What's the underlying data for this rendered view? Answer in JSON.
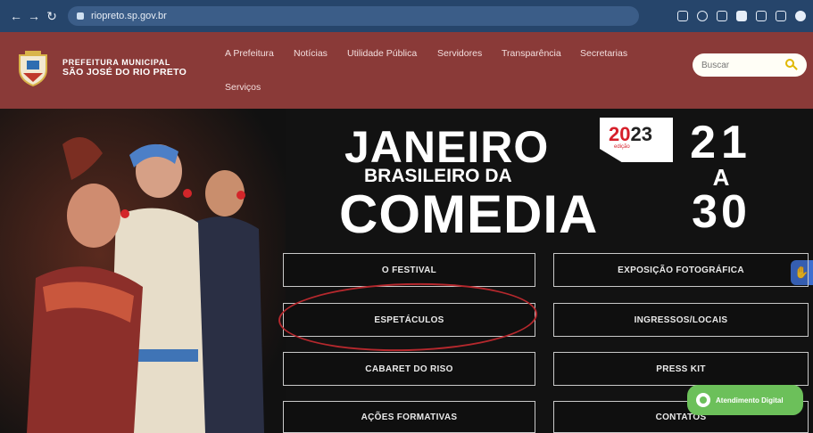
{
  "browser": {
    "url": "riopreto.sp.gov.br",
    "icons": [
      "back-icon",
      "forward-icon",
      "reload-icon",
      "translate-icon",
      "share-icon",
      "star-icon",
      "extension-icon",
      "media-icon",
      "sidebar-icon",
      "profile-icon"
    ]
  },
  "header": {
    "logo_top": "PREFEITURA MUNICIPAL",
    "logo_bottom": "SÃO JOSÉ DO RIO PRETO",
    "nav": [
      {
        "label": "A Prefeitura"
      },
      {
        "label": "Notícias"
      },
      {
        "label": "Utilidade Pública"
      },
      {
        "label": "Servidores"
      },
      {
        "label": "Transparência"
      },
      {
        "label": "Secretarias"
      },
      {
        "label": "Serviços"
      }
    ],
    "search_placeholder": "Buscar"
  },
  "hero": {
    "title_line1": "JANEIRO",
    "title_line2": "BRASILEIRO DA",
    "title_line3": "COMEDIA",
    "edition_year_a": "20",
    "edition_year_b": "23",
    "edition_sub": "edição",
    "date_start": "21",
    "date_mid": "A",
    "date_end": "30"
  },
  "menu": [
    {
      "label": "O FESTIVAL"
    },
    {
      "label": "EXPOSIÇÃO FOTOGRÁFICA"
    },
    {
      "label": "ESPETÁCULOS"
    },
    {
      "label": "INGRESSOS/LOCAIS"
    },
    {
      "label": "CABARET DO RISO"
    },
    {
      "label": "PRESS KIT"
    },
    {
      "label": "AÇÕES FORMATIVAS"
    },
    {
      "label": "CONTATOS"
    }
  ],
  "chat": {
    "label": "Atendimento Digital"
  },
  "colors": {
    "header": "#8a3a38",
    "browser": "#26456b",
    "chat": "#6cc05a",
    "annotation": "#b5282d"
  }
}
